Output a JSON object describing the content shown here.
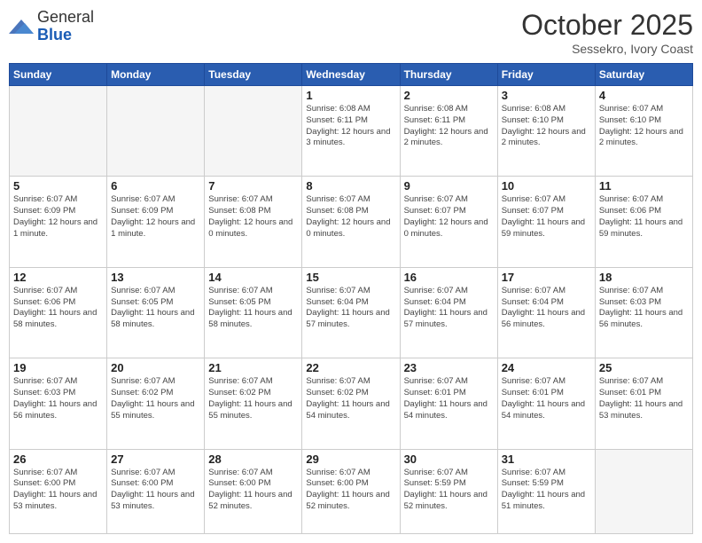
{
  "header": {
    "logo_general": "General",
    "logo_blue": "Blue",
    "month_year": "October 2025",
    "location": "Sessekro, Ivory Coast"
  },
  "weekdays": [
    "Sunday",
    "Monday",
    "Tuesday",
    "Wednesday",
    "Thursday",
    "Friday",
    "Saturday"
  ],
  "weeks": [
    [
      {
        "day": "",
        "info": ""
      },
      {
        "day": "",
        "info": ""
      },
      {
        "day": "",
        "info": ""
      },
      {
        "day": "1",
        "info": "Sunrise: 6:08 AM\nSunset: 6:11 PM\nDaylight: 12 hours and 3 minutes."
      },
      {
        "day": "2",
        "info": "Sunrise: 6:08 AM\nSunset: 6:11 PM\nDaylight: 12 hours and 2 minutes."
      },
      {
        "day": "3",
        "info": "Sunrise: 6:08 AM\nSunset: 6:10 PM\nDaylight: 12 hours and 2 minutes."
      },
      {
        "day": "4",
        "info": "Sunrise: 6:07 AM\nSunset: 6:10 PM\nDaylight: 12 hours and 2 minutes."
      }
    ],
    [
      {
        "day": "5",
        "info": "Sunrise: 6:07 AM\nSunset: 6:09 PM\nDaylight: 12 hours and 1 minute."
      },
      {
        "day": "6",
        "info": "Sunrise: 6:07 AM\nSunset: 6:09 PM\nDaylight: 12 hours and 1 minute."
      },
      {
        "day": "7",
        "info": "Sunrise: 6:07 AM\nSunset: 6:08 PM\nDaylight: 12 hours and 0 minutes."
      },
      {
        "day": "8",
        "info": "Sunrise: 6:07 AM\nSunset: 6:08 PM\nDaylight: 12 hours and 0 minutes."
      },
      {
        "day": "9",
        "info": "Sunrise: 6:07 AM\nSunset: 6:07 PM\nDaylight: 12 hours and 0 minutes."
      },
      {
        "day": "10",
        "info": "Sunrise: 6:07 AM\nSunset: 6:07 PM\nDaylight: 11 hours and 59 minutes."
      },
      {
        "day": "11",
        "info": "Sunrise: 6:07 AM\nSunset: 6:06 PM\nDaylight: 11 hours and 59 minutes."
      }
    ],
    [
      {
        "day": "12",
        "info": "Sunrise: 6:07 AM\nSunset: 6:06 PM\nDaylight: 11 hours and 58 minutes."
      },
      {
        "day": "13",
        "info": "Sunrise: 6:07 AM\nSunset: 6:05 PM\nDaylight: 11 hours and 58 minutes."
      },
      {
        "day": "14",
        "info": "Sunrise: 6:07 AM\nSunset: 6:05 PM\nDaylight: 11 hours and 58 minutes."
      },
      {
        "day": "15",
        "info": "Sunrise: 6:07 AM\nSunset: 6:04 PM\nDaylight: 11 hours and 57 minutes."
      },
      {
        "day": "16",
        "info": "Sunrise: 6:07 AM\nSunset: 6:04 PM\nDaylight: 11 hours and 57 minutes."
      },
      {
        "day": "17",
        "info": "Sunrise: 6:07 AM\nSunset: 6:04 PM\nDaylight: 11 hours and 56 minutes."
      },
      {
        "day": "18",
        "info": "Sunrise: 6:07 AM\nSunset: 6:03 PM\nDaylight: 11 hours and 56 minutes."
      }
    ],
    [
      {
        "day": "19",
        "info": "Sunrise: 6:07 AM\nSunset: 6:03 PM\nDaylight: 11 hours and 56 minutes."
      },
      {
        "day": "20",
        "info": "Sunrise: 6:07 AM\nSunset: 6:02 PM\nDaylight: 11 hours and 55 minutes."
      },
      {
        "day": "21",
        "info": "Sunrise: 6:07 AM\nSunset: 6:02 PM\nDaylight: 11 hours and 55 minutes."
      },
      {
        "day": "22",
        "info": "Sunrise: 6:07 AM\nSunset: 6:02 PM\nDaylight: 11 hours and 54 minutes."
      },
      {
        "day": "23",
        "info": "Sunrise: 6:07 AM\nSunset: 6:01 PM\nDaylight: 11 hours and 54 minutes."
      },
      {
        "day": "24",
        "info": "Sunrise: 6:07 AM\nSunset: 6:01 PM\nDaylight: 11 hours and 54 minutes."
      },
      {
        "day": "25",
        "info": "Sunrise: 6:07 AM\nSunset: 6:01 PM\nDaylight: 11 hours and 53 minutes."
      }
    ],
    [
      {
        "day": "26",
        "info": "Sunrise: 6:07 AM\nSunset: 6:00 PM\nDaylight: 11 hours and 53 minutes."
      },
      {
        "day": "27",
        "info": "Sunrise: 6:07 AM\nSunset: 6:00 PM\nDaylight: 11 hours and 53 minutes."
      },
      {
        "day": "28",
        "info": "Sunrise: 6:07 AM\nSunset: 6:00 PM\nDaylight: 11 hours and 52 minutes."
      },
      {
        "day": "29",
        "info": "Sunrise: 6:07 AM\nSunset: 6:00 PM\nDaylight: 11 hours and 52 minutes."
      },
      {
        "day": "30",
        "info": "Sunrise: 6:07 AM\nSunset: 5:59 PM\nDaylight: 11 hours and 52 minutes."
      },
      {
        "day": "31",
        "info": "Sunrise: 6:07 AM\nSunset: 5:59 PM\nDaylight: 11 hours and 51 minutes."
      },
      {
        "day": "",
        "info": ""
      }
    ]
  ]
}
